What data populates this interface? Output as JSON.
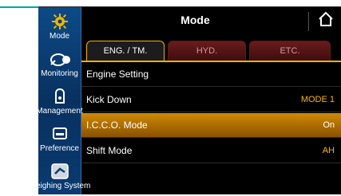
{
  "colors": {
    "accent": "#f0b400",
    "sidebar": "#0a3a70",
    "highlight": "#d08a00"
  },
  "header": {
    "title": "Mode"
  },
  "sidebar": {
    "items": [
      {
        "label": "Mode",
        "icon": "gear-icon"
      },
      {
        "label": "Monitoring",
        "icon": "gauge-icon"
      },
      {
        "label": "Management",
        "icon": "wrench-icon"
      },
      {
        "label": "Preference",
        "icon": "monitor-icon"
      },
      {
        "label": "Weighing System",
        "icon": "scale-icon"
      }
    ]
  },
  "tabs": [
    {
      "label": "ENG. / TM."
    },
    {
      "label": "HYD."
    },
    {
      "label": "ETC."
    }
  ],
  "rows": [
    {
      "name": "Engine Setting",
      "value": ""
    },
    {
      "name": "Kick Down",
      "value": "MODE 1"
    },
    {
      "name": "I.C.C.O. Mode",
      "value": "On"
    },
    {
      "name": "Shift Mode",
      "value": "AH"
    }
  ]
}
